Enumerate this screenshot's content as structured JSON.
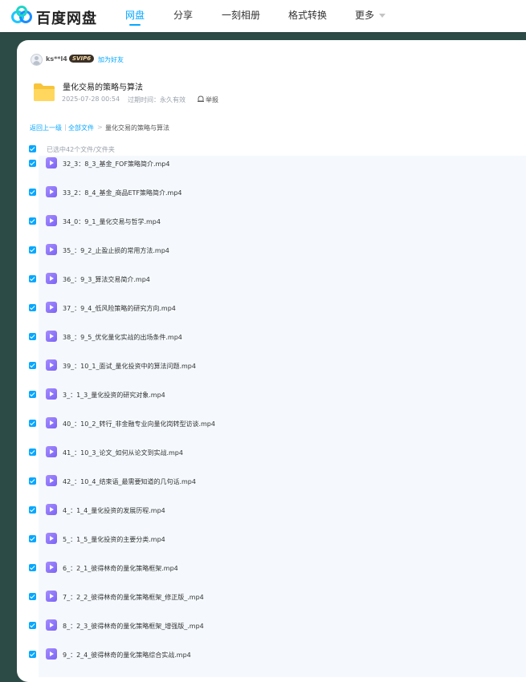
{
  "app": {
    "logo_text": "百度网盘"
  },
  "nav": {
    "items": [
      {
        "label": "网盘",
        "active": true
      },
      {
        "label": "分享",
        "active": false
      },
      {
        "label": "一刻相册",
        "active": false
      },
      {
        "label": "格式转换",
        "active": false
      },
      {
        "label": "更多",
        "active": false
      }
    ]
  },
  "sharer": {
    "username": "ks**l4",
    "vip_badge": "SVIP6",
    "add_friend": "加为好友"
  },
  "share": {
    "title": "量化交易的策略与算法",
    "time": "2025-07-28 00:54",
    "expire": "过期时间：永久有效",
    "report": "举报"
  },
  "breadcrumb": {
    "back": "返回上一级",
    "sep1": "|",
    "all_files": "全部文件",
    "sep2": ">",
    "current": "量化交易的策略与算法"
  },
  "selection": {
    "label": "已选中42个文件/文件夹",
    "checked": true
  },
  "files": [
    {
      "name": "32_3：8_3_基金_FOF策略简介.mp4",
      "checked": true,
      "icon": "video-file-icon"
    },
    {
      "name": "33_2：8_4_基金_商品ETF策略简介.mp4",
      "checked": true,
      "icon": "video-file-icon"
    },
    {
      "name": "34_0：9_1_量化交易与哲学.mp4",
      "checked": true,
      "icon": "video-file-icon"
    },
    {
      "name": "35_：9_2_止盈止损的常用方法.mp4",
      "checked": true,
      "icon": "video-file-icon"
    },
    {
      "name": "36_：9_3_算法交易简介.mp4",
      "checked": true,
      "icon": "video-file-icon"
    },
    {
      "name": "37_：9_4_低风险策略的研究方向.mp4",
      "checked": true,
      "icon": "video-file-icon"
    },
    {
      "name": "38_：9_5_优化量化实战的出场条件.mp4",
      "checked": true,
      "icon": "video-file-icon"
    },
    {
      "name": "39_：10_1_面试_量化投资中的算法问题.mp4",
      "checked": true,
      "icon": "video-file-icon"
    },
    {
      "name": "3_：1_3_量化投资的研究对象.mp4",
      "checked": true,
      "icon": "video-file-icon"
    },
    {
      "name": "40_：10_2_转行_非金融专业向量化岗转型访谈.mp4",
      "checked": true,
      "icon": "video-file-icon"
    },
    {
      "name": "41_：10_3_论文_如何从论文到实战.mp4",
      "checked": true,
      "icon": "video-file-icon"
    },
    {
      "name": "42_：10_4_结束语_最需要知道的几句话.mp4",
      "checked": true,
      "icon": "video-file-icon"
    },
    {
      "name": "4_：1_4_量化投资的发展历程.mp4",
      "checked": true,
      "icon": "video-file-icon"
    },
    {
      "name": "5_：1_5_量化投资的主要分类.mp4",
      "checked": true,
      "icon": "video-file-icon"
    },
    {
      "name": "6_：2_1_彼得林奇的量化策略框架.mp4",
      "checked": true,
      "icon": "video-file-icon"
    },
    {
      "name": "7_：2_2_彼得林奇的量化策略框架_修正版_.mp4",
      "checked": true,
      "icon": "video-file-icon"
    },
    {
      "name": "8_：2_3_彼得林奇的量化策略框架_增强版_.mp4",
      "checked": true,
      "icon": "video-file-icon"
    },
    {
      "name": "9_：2_4_彼得林奇的量化策略综合实战.mp4",
      "checked": true,
      "icon": "video-file-icon"
    }
  ],
  "colors": {
    "accent": "#06a7ff",
    "page_bg": "#2c4b46",
    "list_bg": "#f5f9fd",
    "video_icon": "#7b63f5",
    "folder": "#f7c43a"
  }
}
